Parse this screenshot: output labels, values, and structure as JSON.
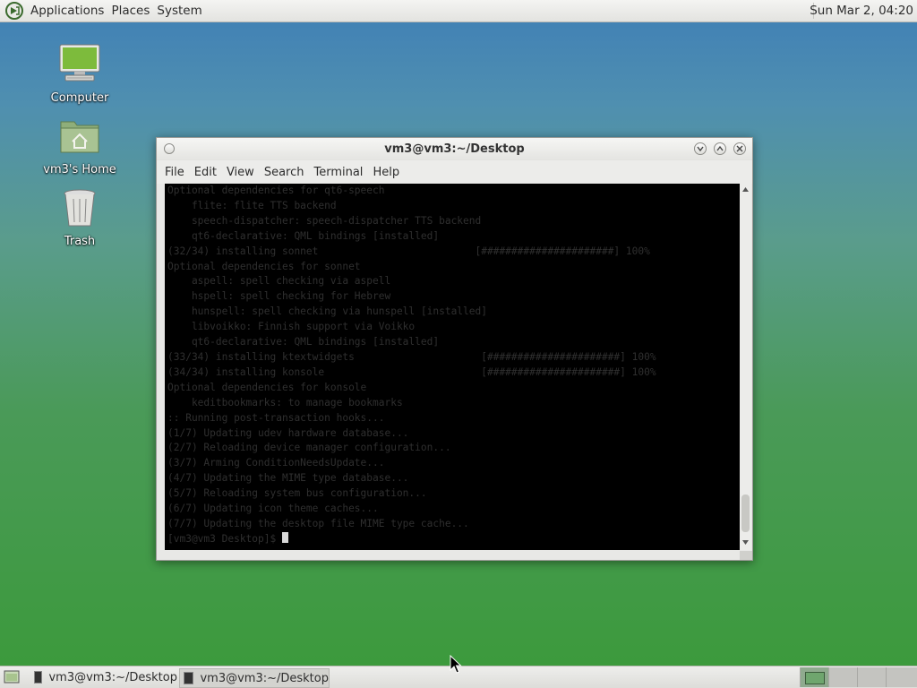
{
  "top_panel": {
    "menus": [
      "Applications",
      "Places",
      "System"
    ],
    "clock": "Sun Mar  2, 04:20"
  },
  "desktop": {
    "icons": [
      {
        "label": "Computer",
        "icon": "computer-icon"
      },
      {
        "label": "vm3's Home",
        "icon": "home-folder-icon"
      },
      {
        "label": "Trash",
        "icon": "trash-icon"
      }
    ]
  },
  "terminal": {
    "title": "vm3@vm3:~/Desktop",
    "menu": [
      "File",
      "Edit",
      "View",
      "Search",
      "Terminal",
      "Help"
    ],
    "lines": [
      "Optional dependencies for qt6-speech",
      "    flite: flite TTS backend",
      "    speech-dispatcher: speech-dispatcher TTS backend",
      "    qt6-declarative: QML bindings [installed]",
      "(32/34) installing sonnet                          [######################] 100%",
      "Optional dependencies for sonnet",
      "    aspell: spell checking via aspell",
      "    hspell: spell checking for Hebrew",
      "    hunspell: spell checking via hunspell [installed]",
      "    libvoikko: Finnish support via Voikko",
      "    qt6-declarative: QML bindings [installed]",
      "(33/34) installing ktextwidgets                     [######################] 100%",
      "(34/34) installing konsole                          [######################] 100%",
      "Optional dependencies for konsole",
      "    keditbookmarks: to manage bookmarks",
      ":: Running post-transaction hooks...",
      "(1/7) Updating udev hardware database...",
      "(2/7) Reloading device manager configuration...",
      "(3/7) Arming ConditionNeedsUpdate...",
      "(4/7) Updating the MIME type database...",
      "(5/7) Reloading system bus configuration...",
      "(6/7) Updating icon theme caches...",
      "(7/7) Updating the desktop file MIME type cache..."
    ],
    "prompt": "[vm3@vm3 Desktop]$ "
  },
  "taskbar": {
    "tasks": [
      "vm3@vm3:~/Desktop",
      "vm3@vm3:~/Desktop"
    ]
  },
  "colors": {
    "desktop_top": "#3f7fb6",
    "desktop_bottom": "#3b9a3a",
    "terminal_bg": "#000000"
  }
}
